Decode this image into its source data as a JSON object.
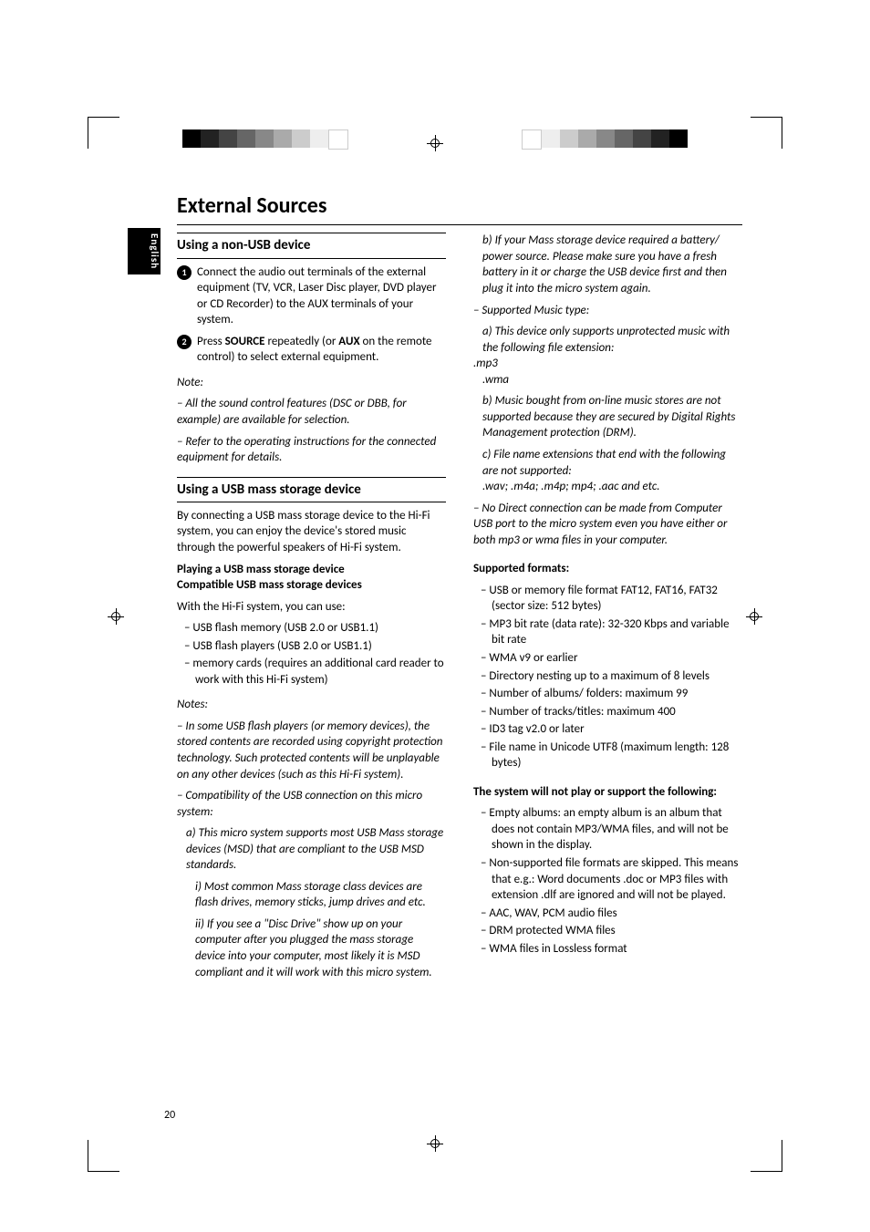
{
  "page_number": "20",
  "side_tab": "English",
  "page_title": "External Sources",
  "col_left": {
    "sect1_title": "Using a non-USB device",
    "step1": "Connect the audio out terminals of the external equipment (TV, VCR, Laser Disc player, DVD player or CD Recorder) to the AUX terminals of your system.",
    "step2_pre": "Press ",
    "step2_b1": "SOURCE",
    "step2_mid": " repeatedly (or ",
    "step2_b2": "AUX",
    "step2_post": " on the remote control) to select external equipment.",
    "note_label": "Note:",
    "note1": "–  All the sound control features (DSC or DBB, for example) are available for selection.",
    "note2": "–  Refer to the operating instructions for the connected equipment for details.",
    "sect2_title": "Using a USB mass storage device",
    "sect2_intro": "By connecting a USB mass storage device to the Hi-Fi system, you can enjoy the device's stored music through the powerful speakers of Hi-Fi system.",
    "play_h1": "Playing a USB mass storage device",
    "play_h2": "Compatible USB mass storage devices",
    "play_lead": "With the Hi-Fi system, you can use:",
    "play_items": [
      "USB flash memory (USB 2.0 or USB1.1)",
      "USB flash players (USB 2.0 or USB1.1)",
      "memory cards (requires an additional card reader to work with this Hi-Fi system)"
    ],
    "notes_label": "Notes:",
    "notes1": "–  In some USB flash players (or memory devices), the stored contents are recorded using copyright protection technology. Such protected contents will be unplayable on any other devices (such as this Hi-Fi system).",
    "notes2": "–  Compatibility of the USB connection on this micro system:",
    "notes2a": "a) This micro system supports most USB Mass storage devices (MSD) that are compliant to the USB MSD standards.",
    "notes2a_i": "i) Most common Mass storage class devices are flash drives, memory sticks, jump drives and etc.",
    "notes2a_ii": "ii) If you see a \"Disc Drive\" show up on your computer after you plugged the mass storage device into your computer, most likely it is MSD compliant and it will work with this micro system."
  },
  "col_right": {
    "cont_b": "b) If your Mass storage device required a battery/ power source. Please make sure you have a fresh battery in it or charge the USB device first and then plug it into the micro system again.",
    "supported_label": "–  Supported Music type:",
    "supported_a": "a) This device only supports unprotected music with the following file extension:",
    "ext1": ".mp3",
    "ext2": ".wma",
    "supported_b": "b) Music bought from on-line music stores are not supported because they are secured by Digital Rights Management protection (DRM).",
    "supported_c": "c) File name extensions that end with the following are not supported:",
    "supported_c_list": ".wav; .m4a; .m4p; mp4; .aac and etc.",
    "nodirect": "–  No Direct connection can be made from Computer USB port to the micro system even you have either or both mp3 or wma files in your computer.",
    "fmt_heading": "Supported formats:",
    "fmt_items": [
      "USB or memory file format FAT12, FAT16, FAT32 (sector size: 512 bytes)",
      "MP3 bit rate (data rate): 32-320 Kbps and variable bit rate",
      "WMA v9 or earlier",
      "Directory nesting up to a maximum of 8 levels",
      "Number of albums/ folders: maximum 99",
      "Number of tracks/titles: maximum 400",
      "ID3 tag v2.0 or later",
      "File name in Unicode UTF8 (maximum length: 128 bytes)"
    ],
    "noplay_heading": "The system will not play or support the following:",
    "noplay_items": [
      "Empty albums: an empty album is an album that does not contain MP3/WMA files, and will not be shown in the display.",
      "Non-supported file formats are skipped. This means that e.g.: Word documents .doc or MP3 files with extension .dlf are ignored and will not be played.",
      "AAC, WAV, PCM audio files",
      "DRM protected WMA files",
      "WMA files in Lossless format"
    ]
  },
  "bar_colors": [
    "#000",
    "#222",
    "#444",
    "#666",
    "#888",
    "#aaa",
    "#ccc",
    "#eee",
    "#fff"
  ]
}
